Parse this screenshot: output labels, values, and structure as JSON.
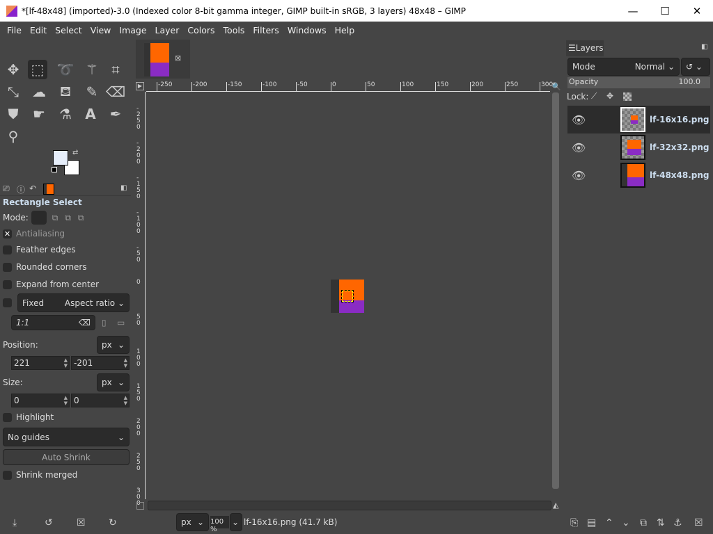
{
  "window": {
    "title": "*[lf-48x48] (imported)-3.0 (Indexed color 8-bit gamma integer, GIMP built-in sRGB, 3 layers) 48x48 – GIMP",
    "minimize": "—",
    "maximize": "☐",
    "close": "✕"
  },
  "menu": [
    "File",
    "Edit",
    "Select",
    "View",
    "Image",
    "Layer",
    "Colors",
    "Tools",
    "Filters",
    "Windows",
    "Help"
  ],
  "tool_options": {
    "title": "Rectangle Select",
    "mode_label": "Mode:",
    "antialiasing": {
      "label": "Antialiasing",
      "checked": true
    },
    "feather": {
      "label": "Feather edges",
      "checked": false
    },
    "rounded": {
      "label": "Rounded corners",
      "checked": false
    },
    "expand": {
      "label": "Expand from center",
      "checked": false
    },
    "fixed": {
      "label": "Fixed",
      "value": "Aspect ratio",
      "checked": false
    },
    "ratio": "1:1",
    "position_label": "Position:",
    "position_unit": "px",
    "pos_x": "221",
    "pos_y": "-201",
    "size_label": "Size:",
    "size_unit": "px",
    "size_w": "0",
    "size_h": "0",
    "highlight": {
      "label": "Highlight",
      "checked": false
    },
    "guides": "No guides",
    "auto_shrink": "Auto Shrink",
    "shrink_merged": {
      "label": "Shrink merged",
      "checked": false
    }
  },
  "hruler": [
    "-250",
    "-200",
    "-150",
    "-100",
    "-50",
    "0",
    "50",
    "100",
    "150",
    "200",
    "250",
    "300"
  ],
  "vruler": [
    "-250",
    "-200",
    "-150",
    "-100",
    "-50",
    "0",
    "50",
    "100",
    "150",
    "200",
    "250",
    "300"
  ],
  "status": {
    "unit": "px",
    "zoom": "100 %",
    "file": "lf-16x16.png (41.7 kB)"
  },
  "layers_panel": {
    "tab": "Layers",
    "mode_label": "Mode",
    "mode": "Normal",
    "opacity_label": "Opacity",
    "opacity": "100.0",
    "lock_label": "Lock:",
    "layers": [
      {
        "name": "lf-16x16.png",
        "visible": true,
        "active": true
      },
      {
        "name": "lf-32x32.png",
        "visible": true
      },
      {
        "name": "lf-48x48.png",
        "visible": true
      }
    ]
  },
  "colors": {
    "orange": "#ff6600",
    "purple": "#8a2cc4",
    "dark": "#333333",
    "accent": "#cde"
  }
}
